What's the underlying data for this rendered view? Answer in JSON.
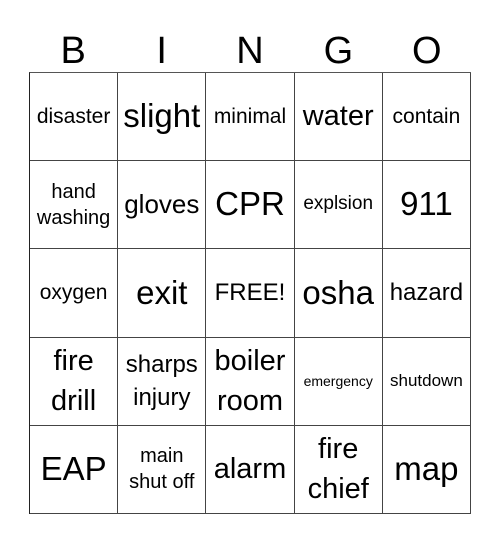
{
  "header": {
    "letters": [
      "B",
      "I",
      "N",
      "G",
      "O"
    ]
  },
  "grid": {
    "rows": [
      [
        "disaster",
        "slight",
        "minimal",
        "water",
        "contain"
      ],
      [
        "hand washing",
        "gloves",
        "CPR",
        "explsion",
        "911"
      ],
      [
        "oxygen",
        "exit",
        "FREE!",
        "osha",
        "hazard"
      ],
      [
        "fire drill",
        "sharps injury",
        "boiler room",
        "emergency",
        "shutdown"
      ],
      [
        "EAP",
        "main shut off",
        "alarm",
        "fire chief",
        "map"
      ]
    ]
  }
}
